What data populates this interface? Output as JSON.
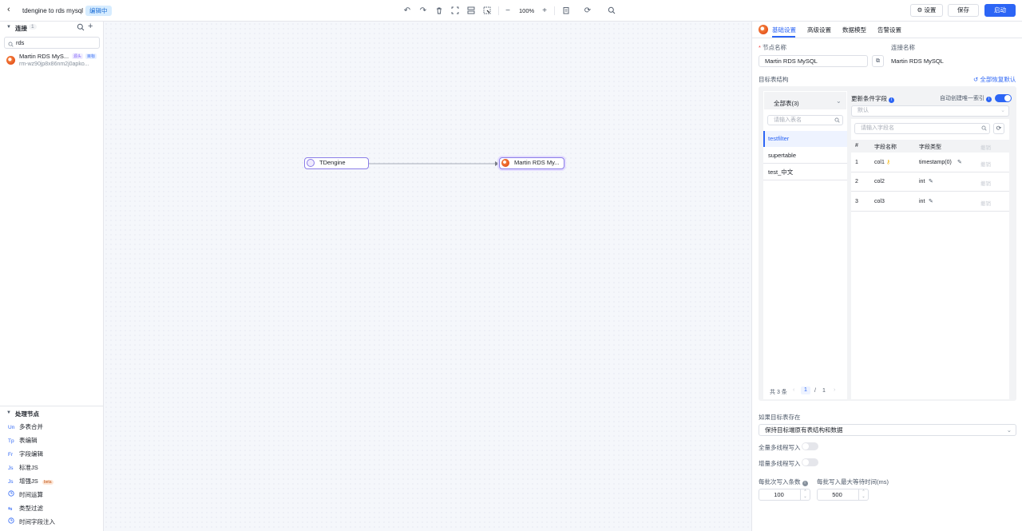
{
  "header": {
    "title": "tdengine to rds mysql",
    "status_badge": "编辑中",
    "zoom_level": "100%",
    "settings_label": "设置",
    "save_label": "保存",
    "start_label": "启动"
  },
  "sidebar": {
    "connections_title": "连接",
    "connections_count": "1",
    "search_value": "rds",
    "connection_items": [
      {
        "name": "Martin RDS MyS...",
        "tag_source": "源头",
        "tag_target": "目标",
        "host": "rm-wz90jp8x86nm2j0apko..."
      }
    ],
    "processors_title": "处理节点",
    "processors": [
      {
        "icon": "Un",
        "label": "多表合并"
      },
      {
        "icon": "Tp",
        "label": "表编辑"
      },
      {
        "icon": "Fr",
        "label": "字段编辑"
      },
      {
        "icon": "Js",
        "label": "标准JS"
      },
      {
        "icon": "Js",
        "label": "增强JS",
        "badge": "beta"
      },
      {
        "icon": "clock",
        "label": "时间运算"
      },
      {
        "icon": "filter",
        "label": "类型过滤"
      },
      {
        "icon": "clock",
        "label": "时间字段注入"
      }
    ]
  },
  "canvas": {
    "source_node": "TDengine",
    "target_node": "Martin RDS My..."
  },
  "panel": {
    "tabs": [
      "基础设置",
      "高级设置",
      "数据模型",
      "告警设置"
    ],
    "node_name_label": "节点名称",
    "node_name_value": "Martin RDS MySQL",
    "conn_name_label": "连接名称",
    "conn_name_value": "Martin RDS MySQL",
    "target_structure_label": "目标表结构",
    "restore_all_label": "全部恢复默认",
    "all_tables_label": "全部表(3)",
    "table_search_placeholder": "请输入表名",
    "tables": [
      "testfilter",
      "supertable",
      "test_中文"
    ],
    "pagination": {
      "total": "共 3 条",
      "current": "1",
      "sep": "/",
      "pages": "1"
    },
    "update_field_label": "更新条件字段",
    "auto_index_label": "自动创建唯一索引",
    "update_field_placeholder": "默认",
    "field_search_placeholder": "请输入字段名",
    "field_table": {
      "headers": [
        "#",
        "字段名称",
        "字段类型",
        "撤销"
      ],
      "rows": [
        {
          "num": "1",
          "name": "col1",
          "type": "timestamp(0)",
          "action": "撤销"
        },
        {
          "num": "2",
          "name": "col2",
          "type": "int",
          "action": "撤销"
        },
        {
          "num": "3",
          "name": "col3",
          "type": "int",
          "action": "撤销"
        }
      ]
    },
    "if_exists_label": "如果目标表存在",
    "if_exists_value": "保持目标端原有表结构和数据",
    "full_multithread_label": "全量多线程写入",
    "incr_multithread_label": "增量多线程写入",
    "batch_count_label": "每批次写入条数",
    "batch_count_value": "100",
    "batch_wait_label": "每批写入最大等待时间(ms)",
    "batch_wait_value": "500"
  },
  "colors": {
    "accent": "#2c65f5",
    "node_border": "#8b7ee8"
  }
}
